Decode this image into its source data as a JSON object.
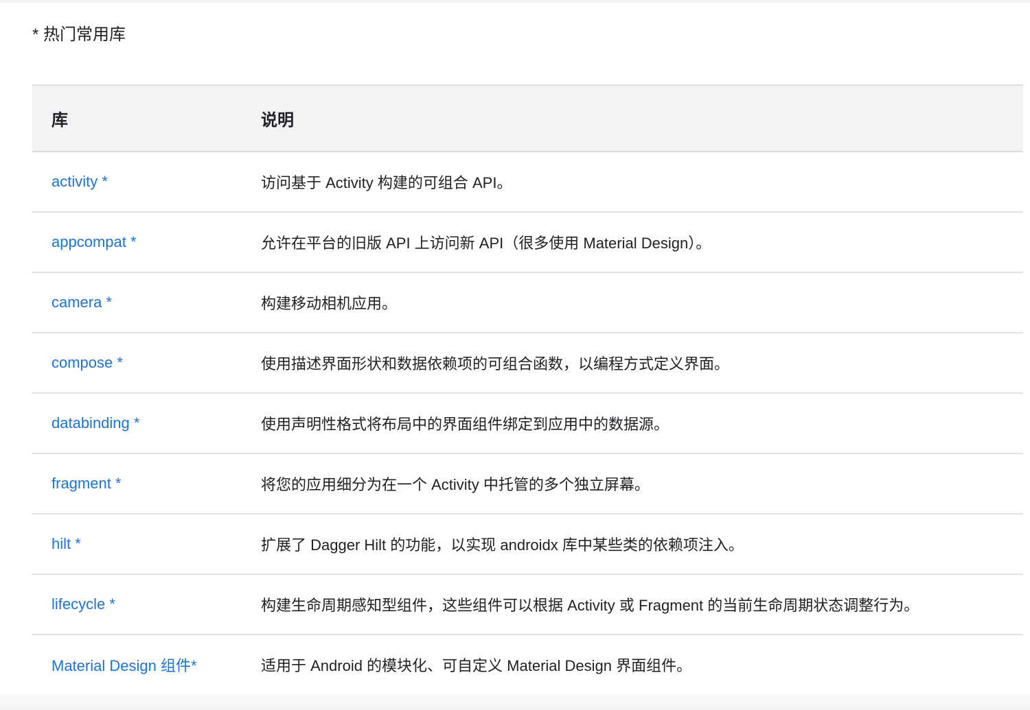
{
  "heading": "* 热门常用库",
  "table": {
    "headers": [
      "库",
      "说明"
    ],
    "rows": [
      {
        "name": "activity *",
        "desc": "访问基于 Activity 构建的可组合 API。"
      },
      {
        "name": "appcompat *",
        "desc": "允许在平台的旧版 API 上访问新 API（很多使用 Material Design）。"
      },
      {
        "name": "camera *",
        "desc": "构建移动相机应用。"
      },
      {
        "name": "compose *",
        "desc": "使用描述界面形状和数据依赖项的可组合函数，以编程方式定义界面。"
      },
      {
        "name": "databinding *",
        "desc": "使用声明性格式将布局中的界面组件绑定到应用中的数据源。"
      },
      {
        "name": "fragment *",
        "desc": "将您的应用细分为在一个 Activity 中托管的多个独立屏幕。"
      },
      {
        "name": "hilt *",
        "desc": "扩展了 Dagger Hilt 的功能，以实现 androidx 库中某些类的依赖项注入。"
      },
      {
        "name": "lifecycle *",
        "desc": "构建生命周期感知型组件，这些组件可以根据 Activity 或 Fragment 的当前生命周期状态调整行为。"
      },
      {
        "name": "Material Design 组件*",
        "desc": "适用于 Android 的模块化、可自定义 Material Design 界面组件。"
      }
    ]
  },
  "colors": {
    "link": "#1a73e8",
    "header_bg": "#f1f3f4"
  }
}
